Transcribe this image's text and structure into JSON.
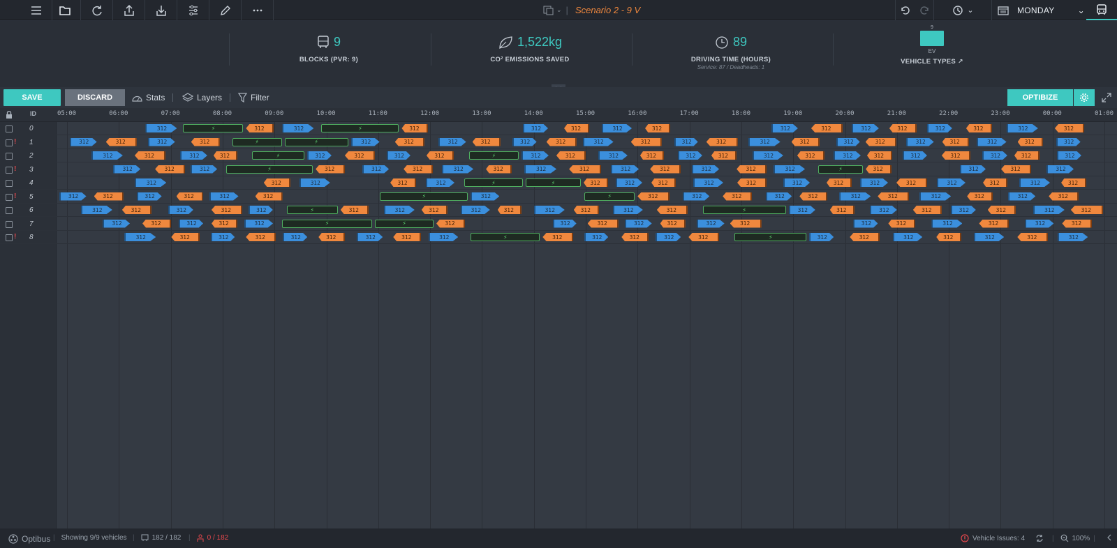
{
  "topbar": {
    "scenario_name": "Scenario 2 - 9 V",
    "day": "MONDAY",
    "icons": [
      "menu-icon",
      "folder-icon",
      "refresh-icon",
      "export-icon",
      "import-icon",
      "sliders-icon",
      "pencil-icon",
      "more-icon",
      "undo-icon",
      "redo-icon",
      "history-icon",
      "calendar-icon",
      "bus-icon"
    ]
  },
  "stats": {
    "blocks": {
      "value": "9",
      "label": "BLOCKS (PVR: 9)"
    },
    "co2": {
      "value": "1,522kg",
      "label": "CO² EMISSIONS SAVED"
    },
    "driving": {
      "value": "89",
      "label": "DRIVING TIME (HOURS)",
      "sub": "Service: 87 / Deadheads: 1"
    },
    "vehicle_types": {
      "count": "9",
      "type": "EV",
      "label": "VEHICLE TYPES"
    }
  },
  "toolbar": {
    "save": "SAVE",
    "discard": "DISCARD",
    "stats": "Stats",
    "layers": "Layers",
    "filter": "Filter",
    "optibize": "OPTIBIZE"
  },
  "grid": {
    "id_header": "ID",
    "hours": [
      "05:00",
      "06:00",
      "07:00",
      "08:00",
      "09:00",
      "10:00",
      "11:00",
      "12:00",
      "13:00",
      "14:00",
      "15:00",
      "16:00",
      "17:00",
      "18:00",
      "19:00",
      "20:00",
      "21:00",
      "22:00",
      "23:00",
      "00:00",
      "01:00"
    ],
    "rows": [
      {
        "id": "0",
        "warn": false
      },
      {
        "id": "1",
        "warn": true
      },
      {
        "id": "2",
        "warn": false
      },
      {
        "id": "3",
        "warn": true
      },
      {
        "id": "4",
        "warn": false
      },
      {
        "id": "5",
        "warn": true
      },
      {
        "id": "6",
        "warn": false
      },
      {
        "id": "7",
        "warn": false
      },
      {
        "id": "8",
        "warn": true
      }
    ],
    "trip_label": "312",
    "colors": {
      "outbound": "#3b8fdd",
      "inbound": "#f0883e",
      "charging": "#4fae5f"
    }
  },
  "footer": {
    "brand": "Optibus",
    "showing": "Showing 9/9 vehicles",
    "trips": "182 / 182",
    "unassigned": "0 / 182",
    "issues": "Vehicle Issues: 4",
    "zoom": "100%"
  }
}
